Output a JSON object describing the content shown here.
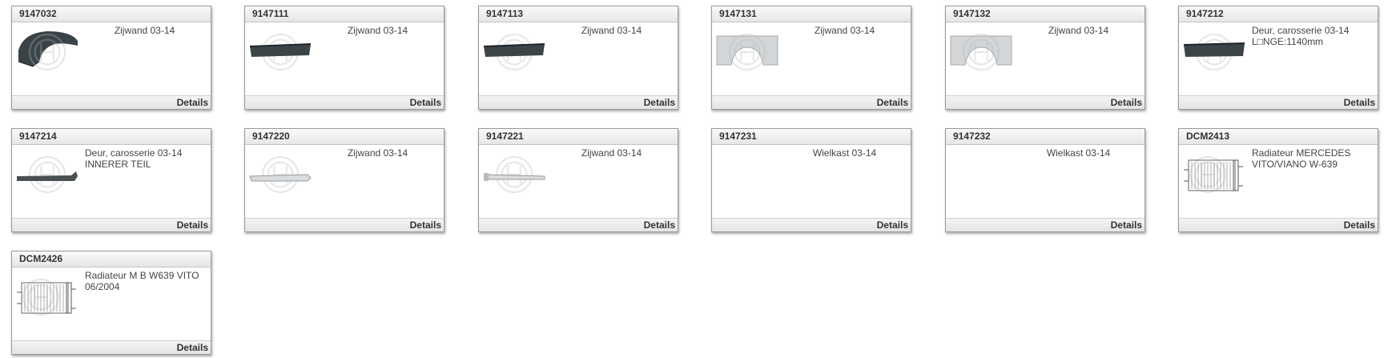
{
  "link_label": "Details",
  "cards": [
    {
      "code": "9147032",
      "text": [
        "Zijwand 03-14"
      ],
      "align": "center",
      "thumb": "rear-arch"
    },
    {
      "code": "9147111",
      "text": [
        "Zijwand 03-14"
      ],
      "align": "center",
      "thumb": "sill-dark"
    },
    {
      "code": "9147113",
      "text": [
        "Zijwand 03-14"
      ],
      "align": "center",
      "thumb": "sill-dark"
    },
    {
      "code": "9147131",
      "text": [
        "Zijwand 03-14"
      ],
      "align": "center",
      "thumb": "arch-light"
    },
    {
      "code": "9147132",
      "text": [
        "Zijwand 03-14"
      ],
      "align": "center",
      "thumb": "arch-light"
    },
    {
      "code": "9147212",
      "text": [
        "Deur, carosserie 03-14",
        "L□NGE:1140mm"
      ],
      "align": "left",
      "thumb": "door-dark"
    },
    {
      "code": "9147214",
      "text": [
        "Deur, carosserie 03-14",
        "INNERER TEIL"
      ],
      "align": "left",
      "thumb": "door-inner"
    },
    {
      "code": "9147220",
      "text": [
        "Zijwand 03-14"
      ],
      "align": "center",
      "thumb": "sill-light"
    },
    {
      "code": "9147221",
      "text": [
        "Zijwand 03-14"
      ],
      "align": "center",
      "thumb": "sill-light2"
    },
    {
      "code": "9147231",
      "text": [
        "Wielkast 03-14"
      ],
      "align": "center",
      "thumb": "none"
    },
    {
      "code": "9147232",
      "text": [
        "Wielkast 03-14"
      ],
      "align": "center",
      "thumb": "none"
    },
    {
      "code": "DCM2413",
      "text": [
        "Radiateur MERCEDES",
        "VITO/VIANO W-639"
      ],
      "align": "left",
      "thumb": "radiator"
    },
    {
      "code": "DCM2426",
      "text": [
        "Radiateur M B W639 VITO",
        "06/2004"
      ],
      "align": "left",
      "thumb": "radiator"
    }
  ]
}
